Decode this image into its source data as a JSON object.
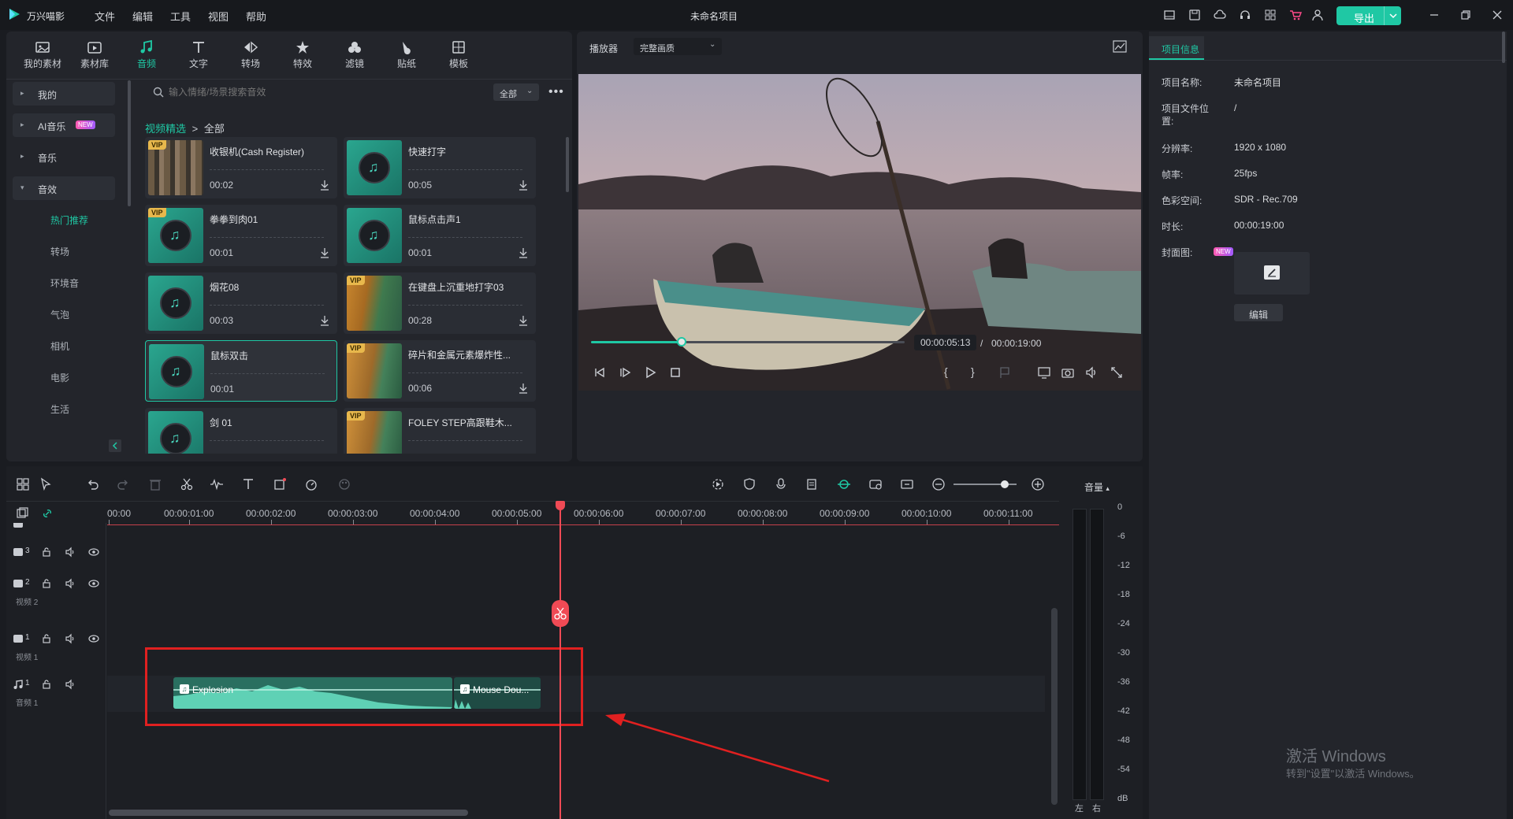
{
  "app": {
    "name": "万兴喵影",
    "project_title": "未命名项目",
    "menu": [
      "文件",
      "编辑",
      "工具",
      "视图",
      "帮助"
    ],
    "export_label": "导出"
  },
  "toolbar_tabs": [
    {
      "label": "我的素材",
      "icon": "folder-icon"
    },
    {
      "label": "素材库",
      "icon": "library-icon"
    },
    {
      "label": "音频",
      "icon": "music-note-icon"
    },
    {
      "label": "文字",
      "icon": "text-icon"
    },
    {
      "label": "转场",
      "icon": "transition-icon"
    },
    {
      "label": "特效",
      "icon": "effects-icon"
    },
    {
      "label": "滤镜",
      "icon": "filter-icon"
    },
    {
      "label": "贴纸",
      "icon": "sticker-icon"
    },
    {
      "label": "模板",
      "icon": "template-icon"
    }
  ],
  "sidebar": {
    "groups": [
      {
        "label": "我的",
        "badge": ""
      },
      {
        "label": "AI音乐",
        "badge": "NEW"
      },
      {
        "label": "音乐",
        "badge": ""
      },
      {
        "label": "音效",
        "badge": ""
      }
    ],
    "subitems": [
      "热门推荐",
      "转场",
      "环境音",
      "气泡",
      "相机",
      "电影",
      "生活"
    ]
  },
  "search": {
    "placeholder": "输入情绪/场景搜索音效",
    "filter": "全部"
  },
  "breadcrumb": {
    "root": "视频精选",
    "sep": ">",
    "current": "全部"
  },
  "cards": [
    {
      "name": "收银机(Cash Register)",
      "duration": "00:02",
      "vip": "VIP"
    },
    {
      "name": "快速打字",
      "duration": "00:05",
      "vip": ""
    },
    {
      "name": "拳拳到肉01",
      "duration": "00:01",
      "vip": "VIP"
    },
    {
      "name": "鼠标点击声1",
      "duration": "00:01",
      "vip": ""
    },
    {
      "name": "烟花08",
      "duration": "00:03",
      "vip": ""
    },
    {
      "name": "在键盘上沉重地打字03",
      "duration": "00:28",
      "vip": "VIP"
    },
    {
      "name": "鼠标双击",
      "duration": "00:01",
      "vip": ""
    },
    {
      "name": "碎片和金属元素爆炸性...",
      "duration": "00:06",
      "vip": "VIP"
    },
    {
      "name": "剑 01",
      "duration": "",
      "vip": ""
    },
    {
      "name": "FOLEY STEP高跟鞋木...",
      "duration": "",
      "vip": "VIP"
    }
  ],
  "player": {
    "label": "播放器",
    "quality": "完整画质",
    "current_time": "00:00:05:13",
    "separator": "/",
    "total_time": "00:00:19:00",
    "progress": 0.29
  },
  "project_info": {
    "tab": "项目信息",
    "rows": [
      {
        "k": "项目名称:",
        "v": "未命名项目"
      },
      {
        "k": "项目文件位置:",
        "v": "/"
      },
      {
        "k": "分辨率:",
        "v": "1920 x 1080"
      },
      {
        "k": "帧率:",
        "v": "25fps"
      },
      {
        "k": "色彩空间:",
        "v": "SDR - Rec.709"
      },
      {
        "k": "时长:",
        "v": "00:00:19:00"
      }
    ],
    "cover_label": "封面图:",
    "cover_badge": "NEW",
    "edit_button": "编辑"
  },
  "timeline": {
    "ruler": [
      "00:00",
      "00:00:01:00",
      "00:00:02:00",
      "00:00:03:00",
      "00:00:04:00",
      "00:00:05:00",
      "00:00:06:00",
      "00:00:07:00",
      "00:00:08:00",
      "00:00:09:00",
      "00:00:10:00",
      "00:00:11:00"
    ],
    "tracks": [
      {
        "num": "3",
        "name": ""
      },
      {
        "num": "2",
        "name": "视频 2"
      },
      {
        "num": "1",
        "name": "视频 1"
      },
      {
        "num": "1",
        "name": "音频 1"
      }
    ],
    "clips": [
      {
        "name": "Explosion"
      },
      {
        "name": "Mouse Dou..."
      }
    ]
  },
  "volume": {
    "label": "音量",
    "scale": [
      "0",
      "-6",
      "-12",
      "-18",
      "-24",
      "-30",
      "-36",
      "-42",
      "-48",
      "-54",
      "dB"
    ],
    "left": "左",
    "right": "右"
  },
  "watermark": {
    "line1": "激活 Windows",
    "line2": "转到\"设置\"以激活 Windows。"
  },
  "colors": {
    "accent": "#1fc8a4",
    "playhead": "#f04a55",
    "highlight_box": "#e02020",
    "vip": "#e8b84c"
  }
}
